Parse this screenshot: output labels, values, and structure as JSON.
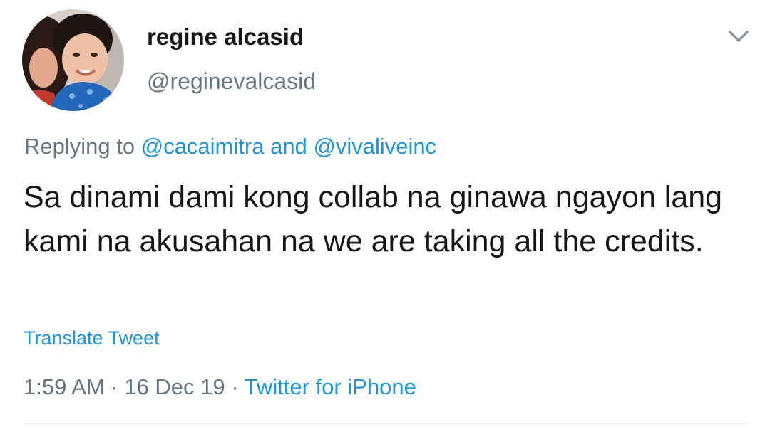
{
  "tweet": {
    "user": {
      "display_name": "regine alcasid",
      "handle": "@reginevalcasid"
    },
    "reply": {
      "prefix": "Replying to",
      "mention_1": "@cacaimitra",
      "connector": "and",
      "mention_2": "@vivaliveinc"
    },
    "text": "Sa dinami dami kong collab na ginawa ngayon lang kami na akusahan na we are taking all the credits.",
    "translate_label": "Translate Tweet",
    "time": "1:59 AM",
    "date": "16 Dec 19",
    "separator": "·",
    "source": "Twitter for iPhone"
  },
  "icons": {
    "caret": "chevron-down-icon",
    "avatar": "avatar"
  },
  "colors": {
    "text_primary": "#14171a",
    "text_secondary": "#657786",
    "link": "#1b95e0",
    "divider": "#e1e8ed"
  }
}
